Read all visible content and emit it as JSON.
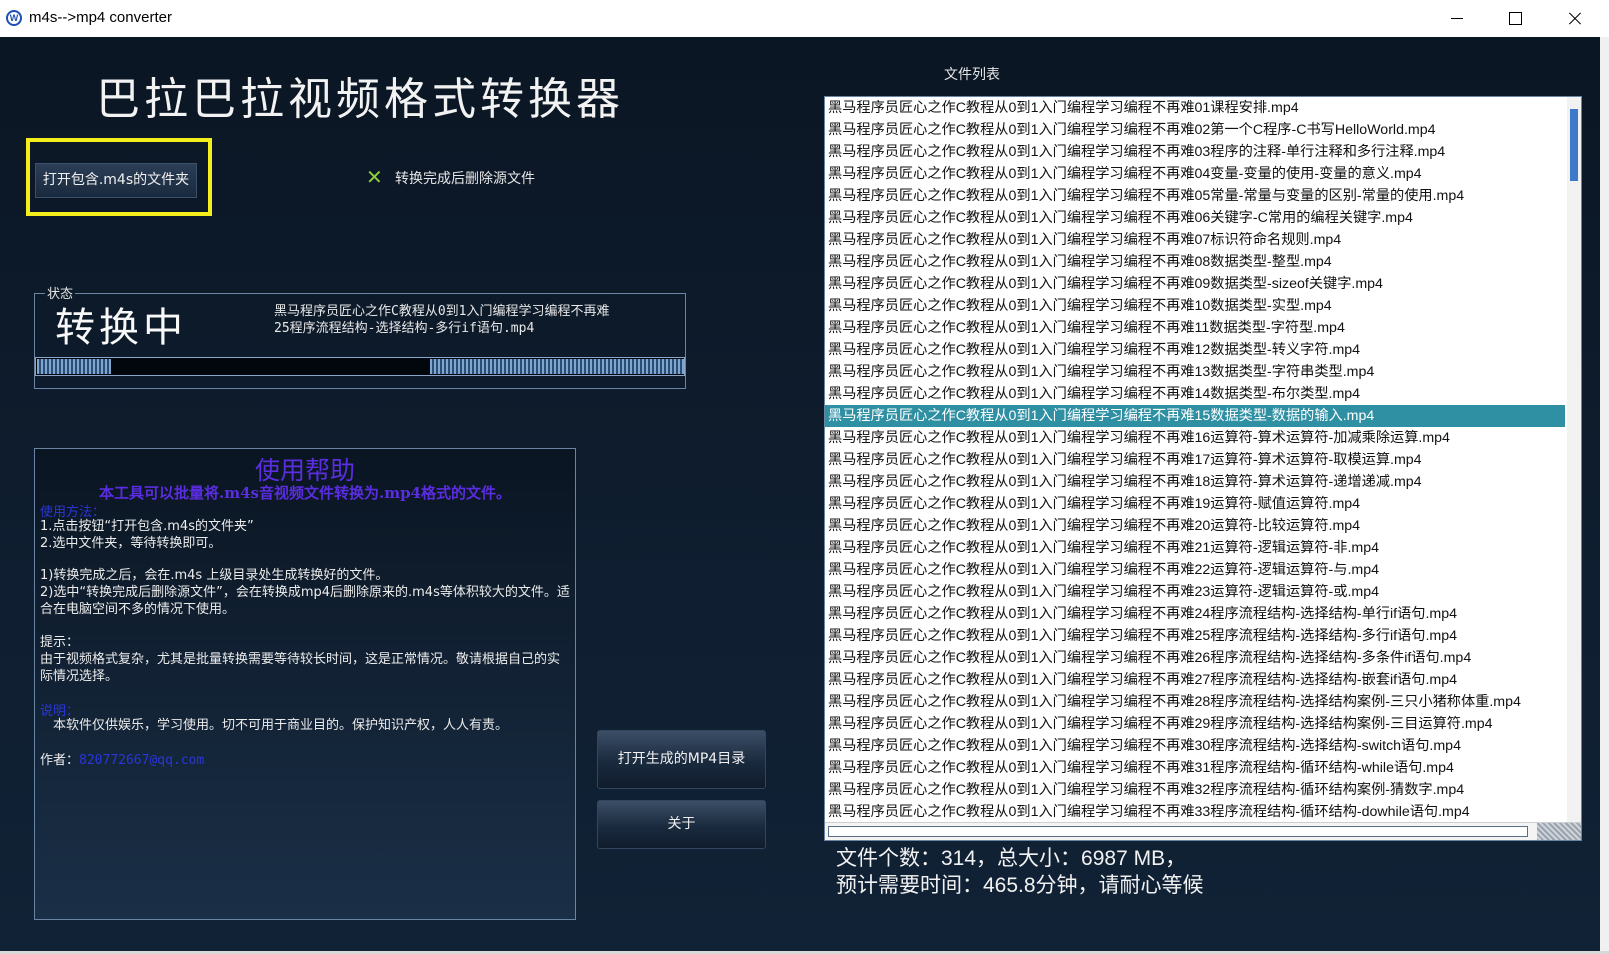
{
  "window": {
    "title": "m4s-->mp4 converter",
    "icon": "vw-logo-icon"
  },
  "app_title": "巴拉巴拉视频格式转换器",
  "open_folder_button": "打开包含.m4s的文件夹",
  "delete_source": {
    "label": "转换完成后删除源文件",
    "checked": true
  },
  "status": {
    "legend": "状态",
    "state": "转换中",
    "current_file_line1": "黑马程序员匠心之作C教程从0到1入门编程学习编程不再难",
    "current_file_line2": "25程序流程结构-选择结构-多行if语句.mp4"
  },
  "help": {
    "title": "使用帮助",
    "subtitle": "本工具可以批量将.m4s音视频文件转换为.mp4格式的文件。",
    "usage_heading": "使用方法：",
    "step1": "1.点击按钮“打开包含.m4s的文件夹”",
    "step2": "2.选中文件夹，等待转换即可。",
    "note1": "1)转换完成之后，会在.m4s 上级目录处生成转换好的文件。",
    "note2": "2)选中“转换完成后删除源文件”，会在转换成mp4后删除原来的.m4s等体积较大的文件。适合在电脑空间不多的情况下使用。",
    "tip_heading": "提示：",
    "tip_text": "由于视频格式复杂，尤其是批量转换需要等待较长时间，这是正常情况。敬请根据自己的实际情况选择。",
    "notice_heading": "说明：",
    "notice_text": "本软件仅供娱乐，学习使用。切不可用于商业目的。保护知识产权，人人有责。",
    "author_label": "作者：",
    "author_email": "820772667@qq.com"
  },
  "buttons": {
    "open_mp4_dir": "打开生成的MP4目录",
    "about": "关于"
  },
  "file_list": {
    "label": "文件列表",
    "selected_index": 14,
    "items": [
      "黑马程序员匠心之作C教程从0到1入门编程学习编程不再难01课程安排.mp4",
      "黑马程序员匠心之作C教程从0到1入门编程学习编程不再难02第一个C程序-C书写HelloWorld.mp4",
      "黑马程序员匠心之作C教程从0到1入门编程学习编程不再难03程序的注释-单行注释和多行注释.mp4",
      "黑马程序员匠心之作C教程从0到1入门编程学习编程不再难04变量-变量的使用-变量的意义.mp4",
      "黑马程序员匠心之作C教程从0到1入门编程学习编程不再难05常量-常量与变量的区别-常量的使用.mp4",
      "黑马程序员匠心之作C教程从0到1入门编程学习编程不再难06关键字-C常用的编程关键字.mp4",
      "黑马程序员匠心之作C教程从0到1入门编程学习编程不再难07标识符命名规则.mp4",
      "黑马程序员匠心之作C教程从0到1入门编程学习编程不再难08数据类型-整型.mp4",
      "黑马程序员匠心之作C教程从0到1入门编程学习编程不再难09数据类型-sizeof关键字.mp4",
      "黑马程序员匠心之作C教程从0到1入门编程学习编程不再难10数据类型-实型.mp4",
      "黑马程序员匠心之作C教程从0到1入门编程学习编程不再难11数据类型-字符型.mp4",
      "黑马程序员匠心之作C教程从0到1入门编程学习编程不再难12数据类型-转义字符.mp4",
      "黑马程序员匠心之作C教程从0到1入门编程学习编程不再难13数据类型-字符串类型.mp4",
      "黑马程序员匠心之作C教程从0到1入门编程学习编程不再难14数据类型-布尔类型.mp4",
      "黑马程序员匠心之作C教程从0到1入门编程学习编程不再难15数据类型-数据的输入.mp4",
      "黑马程序员匠心之作C教程从0到1入门编程学习编程不再难16运算符-算术运算符-加减乘除运算.mp4",
      "黑马程序员匠心之作C教程从0到1入门编程学习编程不再难17运算符-算术运算符-取模运算.mp4",
      "黑马程序员匠心之作C教程从0到1入门编程学习编程不再难18运算符-算术运算符-递增递减.mp4",
      "黑马程序员匠心之作C教程从0到1入门编程学习编程不再难19运算符-赋值运算符.mp4",
      "黑马程序员匠心之作C教程从0到1入门编程学习编程不再难20运算符-比较运算符.mp4",
      "黑马程序员匠心之作C教程从0到1入门编程学习编程不再难21运算符-逻辑运算符-非.mp4",
      "黑马程序员匠心之作C教程从0到1入门编程学习编程不再难22运算符-逻辑运算符-与.mp4",
      "黑马程序员匠心之作C教程从0到1入门编程学习编程不再难23运算符-逻辑运算符-或.mp4",
      "黑马程序员匠心之作C教程从0到1入门编程学习编程不再难24程序流程结构-选择结构-单行if语句.mp4",
      "黑马程序员匠心之作C教程从0到1入门编程学习编程不再难25程序流程结构-选择结构-多行if语句.mp4",
      "黑马程序员匠心之作C教程从0到1入门编程学习编程不再难26程序流程结构-选择结构-多条件if语句.mp4",
      "黑马程序员匠心之作C教程从0到1入门编程学习编程不再难27程序流程结构-选择结构-嵌套if语句.mp4",
      "黑马程序员匠心之作C教程从0到1入门编程学习编程不再难28程序流程结构-选择结构案例-三只小猪称体重.mp4",
      "黑马程序员匠心之作C教程从0到1入门编程学习编程不再难29程序流程结构-选择结构案例-三目运算符.mp4",
      "黑马程序员匠心之作C教程从0到1入门编程学习编程不再难30程序流程结构-选择结构-switch语句.mp4",
      "黑马程序员匠心之作C教程从0到1入门编程学习编程不再难31程序流程结构-循环结构-while语句.mp4",
      "黑马程序员匠心之作C教程从0到1入门编程学习编程不再难32程序流程结构-循环结构案例-猜数字.mp4",
      "黑马程序员匠心之作C教程从0到1入门编程学习编程不再难33程序流程结构-循环结构-dowhile语句.mp4"
    ]
  },
  "summary": {
    "line1": "文件个数：314，总大小：6987 MB，",
    "line2": "预计需要时间：465.8分钟，请耐心等候"
  },
  "colors": {
    "highlight": "#f3ee1c",
    "help_title": "#5b2de0",
    "help_heading": "#2a36d8",
    "check": "#8ccf3b",
    "selected_row": "#2f8fa3"
  }
}
